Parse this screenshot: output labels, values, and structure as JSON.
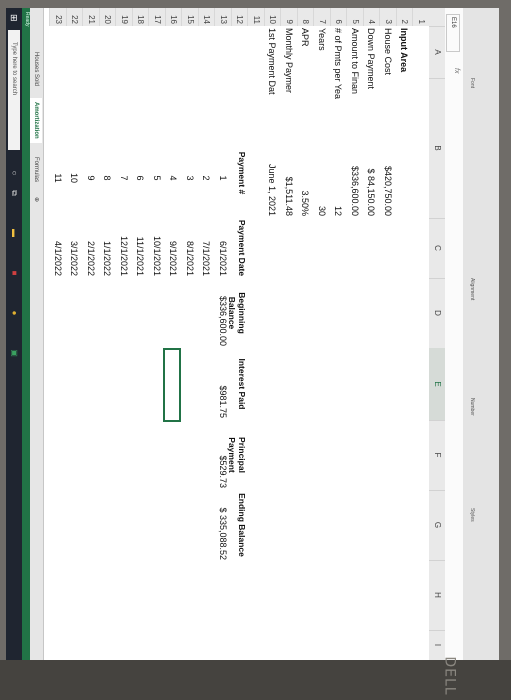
{
  "ribbon": {
    "groups": [
      "Font",
      "Alignment",
      "Number",
      "Styles"
    ]
  },
  "formula_bar": {
    "name_box": "E16",
    "fx": "fx"
  },
  "columns": [
    "A",
    "B",
    "C",
    "D",
    "E",
    "F",
    "G",
    "H",
    "I"
  ],
  "rows": [
    "1",
    "2",
    "3",
    "4",
    "5",
    "6",
    "7",
    "8",
    "9",
    "10",
    "11",
    "12",
    "13",
    "14",
    "15",
    "16",
    "17",
    "18",
    "19",
    "20",
    "21",
    "22",
    "23"
  ],
  "input_area": {
    "title": "Input Area",
    "rows": [
      {
        "label": "House Cost",
        "value": "$420,750.00"
      },
      {
        "label": "Down Payment",
        "value": "$  84,150.00"
      },
      {
        "label": "Amount to Finan",
        "value": "$336,600.00"
      },
      {
        "label": "# of Pmts per Yea",
        "value": "12"
      },
      {
        "label": "Years",
        "value": "30"
      },
      {
        "label": "APR",
        "value": "3.50%"
      },
      {
        "label": "Monthly Paymer",
        "value": "$1,511.48"
      },
      {
        "label": "1st Payment Dat",
        "value": "June 1, 2021"
      }
    ]
  },
  "table": {
    "headers": [
      "Payment #",
      "Payment Date",
      "Beginning Balance",
      "Interest Paid",
      "Principal Payment",
      "Ending Balance"
    ],
    "rows": [
      {
        "num": "1",
        "date": "6/1/2021",
        "begin": "$336,600.00",
        "interest": "$981.75",
        "principal": "$529.73",
        "end": "$ 335,088.52"
      },
      {
        "num": "2",
        "date": "7/1/2021"
      },
      {
        "num": "3",
        "date": "8/1/2021"
      },
      {
        "num": "4",
        "date": "9/1/2021"
      },
      {
        "num": "5",
        "date": "10/1/2021"
      },
      {
        "num": "6",
        "date": "11/1/2021"
      },
      {
        "num": "7",
        "date": "12/1/2021"
      },
      {
        "num": "8",
        "date": "1/1/2022"
      },
      {
        "num": "9",
        "date": "2/1/2022"
      },
      {
        "num": "10",
        "date": "3/1/2022"
      },
      {
        "num": "11",
        "date": "4/1/2022"
      }
    ]
  },
  "tabs": [
    "Houses Sold",
    "Amortization",
    "Formulas"
  ],
  "active_tab": "Amortization",
  "status": "Ready",
  "taskbar": {
    "search_placeholder": "Type here to search"
  },
  "brand": "DELL"
}
